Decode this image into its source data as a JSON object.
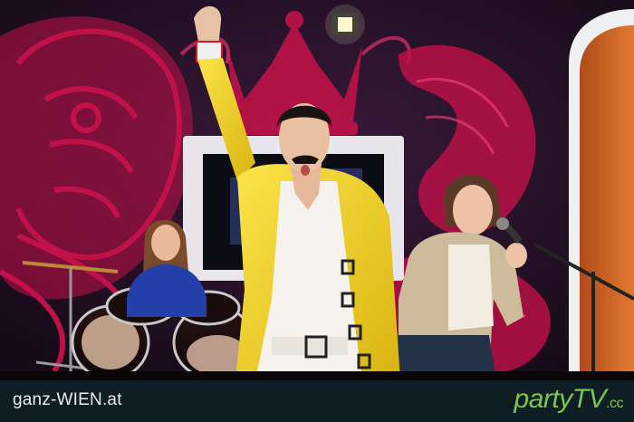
{
  "footer": {
    "left_brand_pre": "ga",
    "left_brand_post": "nz-WIEN.at",
    "right_brand": "partyTV",
    "right_suffix": ".cc"
  },
  "colors": {
    "footer_bg": "#0f1d24",
    "accent_red": "#d21a2a",
    "accent_green": "#79c84a",
    "jacket_yellow": "#f2d21a",
    "mural_magenta": "#d0124c"
  }
}
